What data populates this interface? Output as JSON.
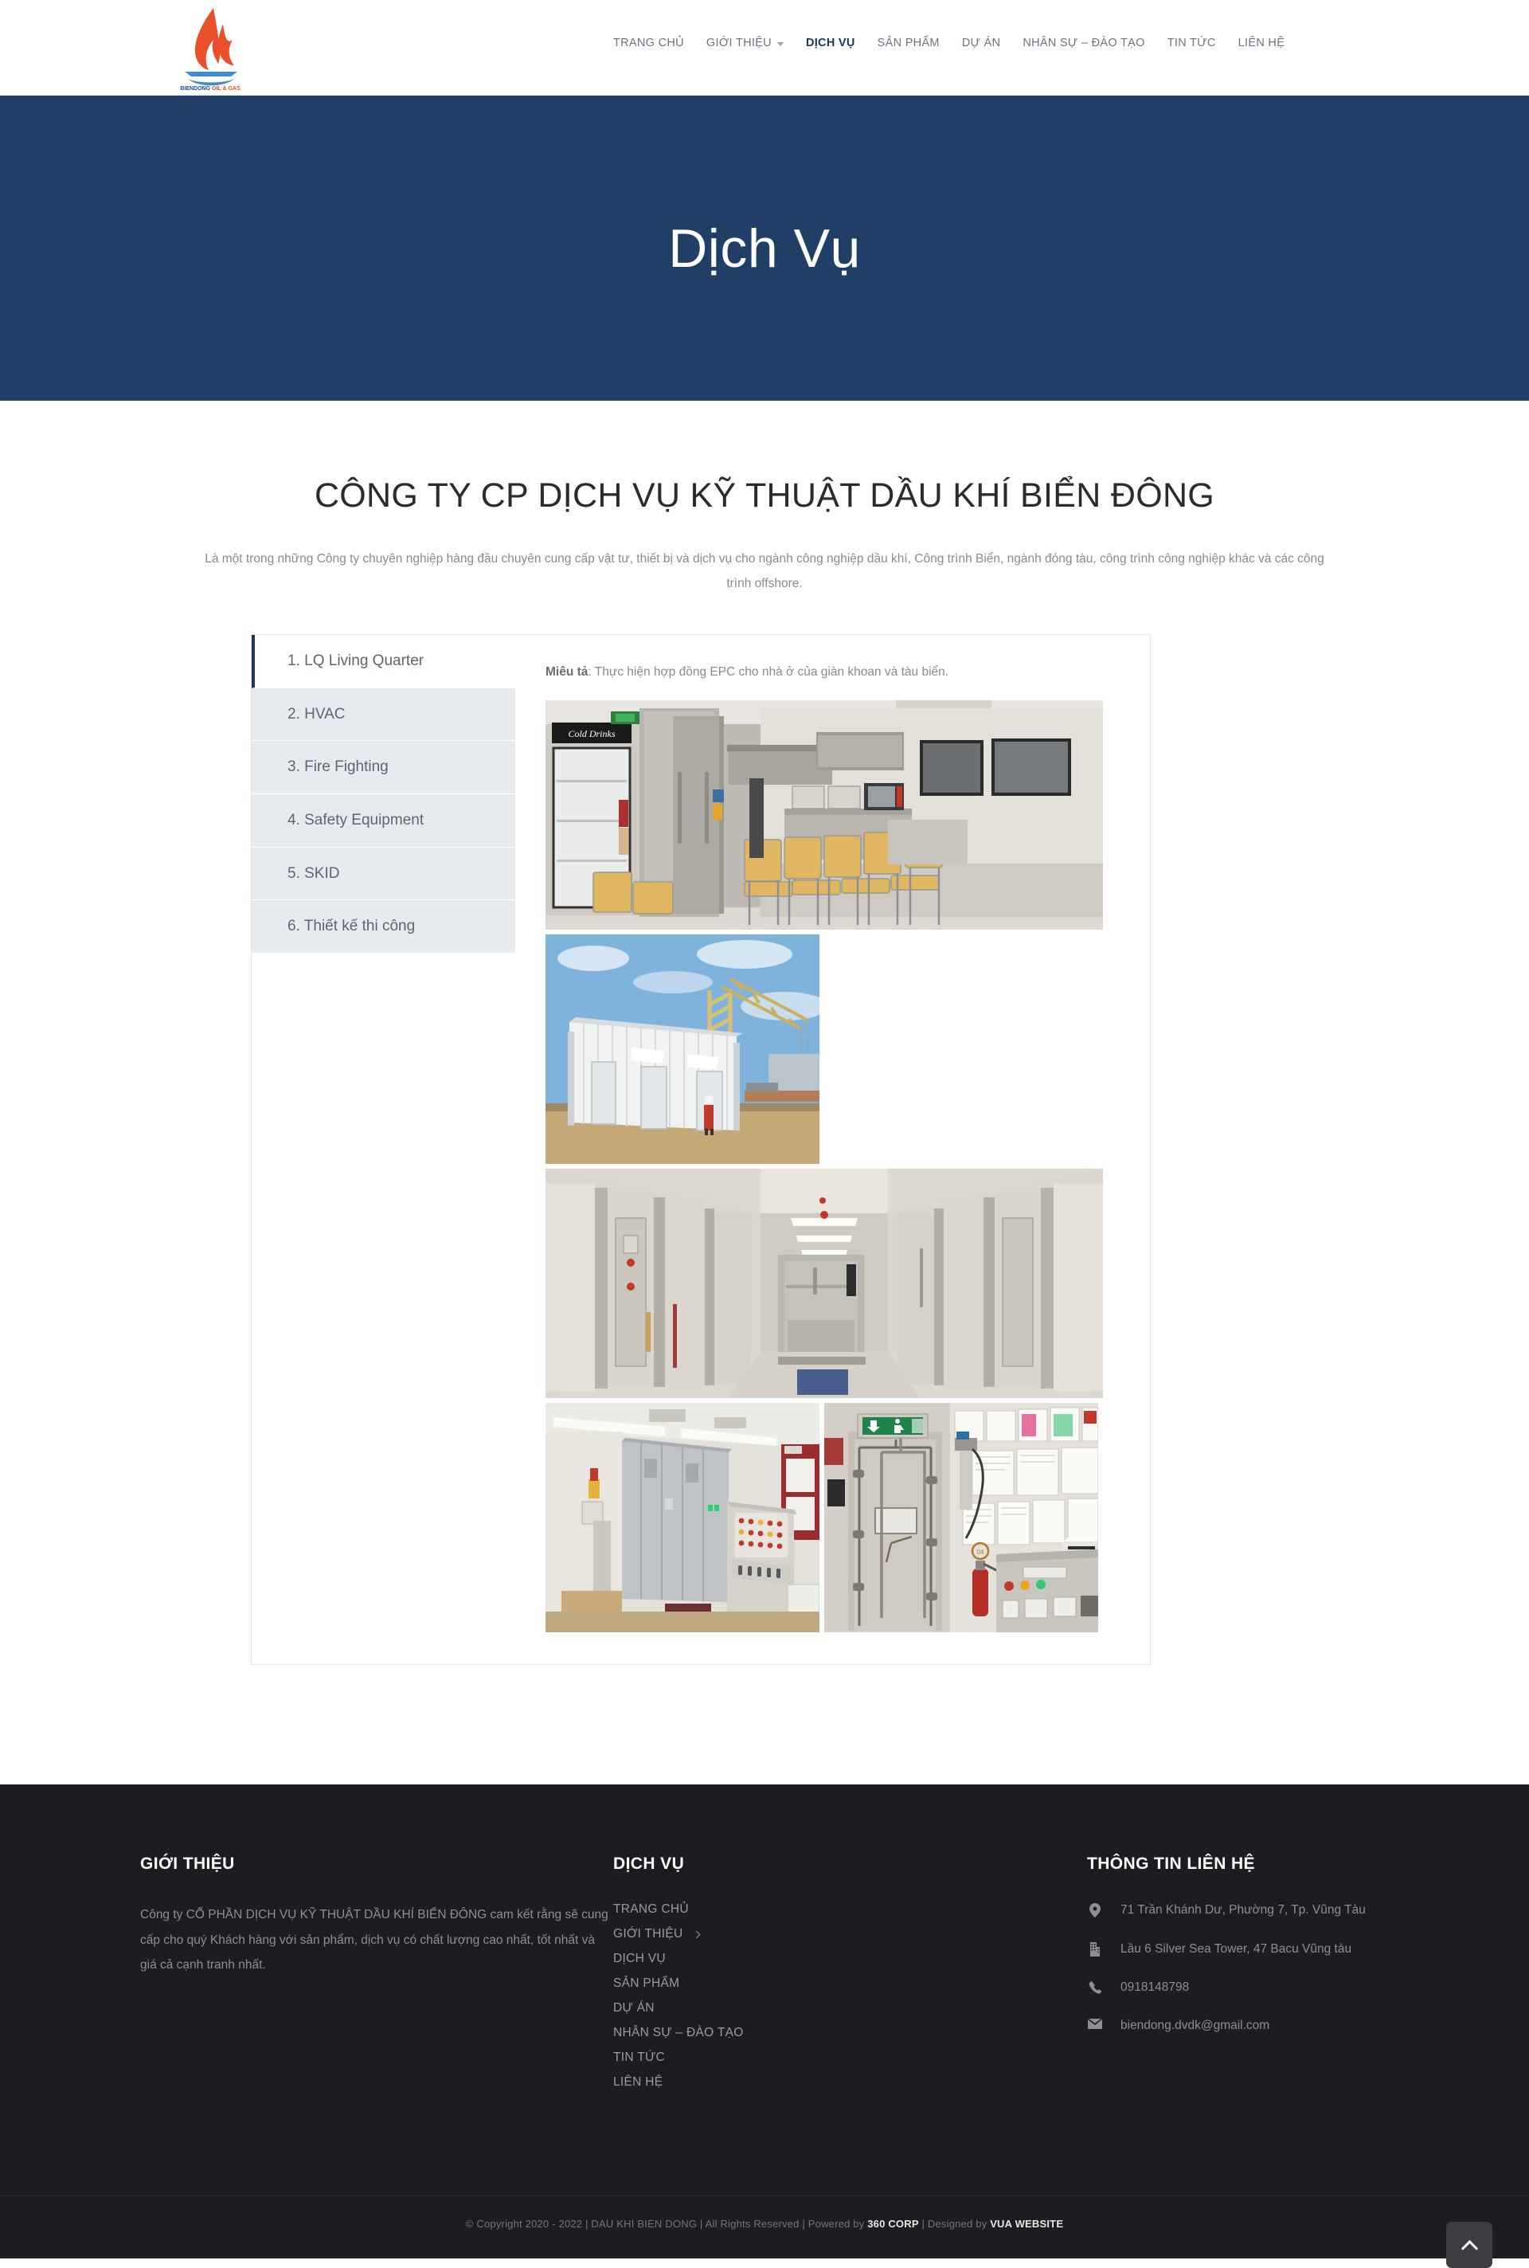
{
  "header": {
    "logo": {
      "name": "biendong-oil-gas-logo",
      "text": "BIENDONG OIL & GAS",
      "flame_color": "#e8502a",
      "wave_color": "#3b8ed0"
    },
    "nav": [
      {
        "label": "TRANG CHỦ",
        "active": false,
        "has_caret": false
      },
      {
        "label": "GIỚI THIỆU",
        "active": false,
        "has_caret": true
      },
      {
        "label": "DỊCH VỤ",
        "active": true,
        "has_caret": false
      },
      {
        "label": "SẢN PHẨM",
        "active": false,
        "has_caret": false
      },
      {
        "label": "DỰ ÁN",
        "active": false,
        "has_caret": false
      },
      {
        "label": "NHÂN SỰ – ĐÀO TẠO",
        "active": false,
        "has_caret": false
      },
      {
        "label": "TIN TỨC",
        "active": false,
        "has_caret": false
      },
      {
        "label": "LIÊN HỆ",
        "active": false,
        "has_caret": false
      }
    ]
  },
  "hero": {
    "title": "Dịch Vụ",
    "background_color": "#213f66"
  },
  "main": {
    "heading": "CÔNG TY CP DỊCH VỤ KỸ THUẬT DẦU KHÍ BIỂN ĐÔNG",
    "intro": "Là một trong những Công ty chuyên nghiệp hàng đầu chuyên cung cấp vật tư, thiết bị và dịch vụ cho ngành công nghiệp dầu khí, Công trình Biển, ngành đóng tàu, công trình công nghiệp khác và các công trình offshore.",
    "tabs": [
      {
        "label": "1. LQ Living Quarter",
        "active": true
      },
      {
        "label": "2. HVAC",
        "active": false
      },
      {
        "label": "3. Fire Fighting",
        "active": false
      },
      {
        "label": "4. Safety Equipment",
        "active": false
      },
      {
        "label": "5. SKID",
        "active": false
      },
      {
        "label": "6. Thiết kế thi công",
        "active": false
      }
    ],
    "panel": {
      "desc_label": "Miêu tả",
      "desc_text": ": Thực hiện hợp đồng EPC cho nhà ở của giàn khoan và tàu biển.",
      "photos": [
        {
          "name": "photo-galley-mess-room"
        },
        {
          "name": "photo-module-exterior-crane"
        },
        {
          "name": "photo-accommodation-corridor"
        },
        {
          "name": "photo-electrical-control-room"
        },
        {
          "name": "photo-watertight-door-panel"
        }
      ]
    }
  },
  "footer": {
    "col1": {
      "title": "GIỚI THIỆU",
      "text": "Công ty CỔ PHẦN DỊCH VỤ KỸ THUẬT DẦU KHÍ BIỂN ĐÔNG cam kết rằng sẽ cung cấp cho quý Khách hàng với sản phẩm, dịch vụ có chất lượng cao nhất, tốt nhất và giá cả cạnh tranh nhất."
    },
    "col2": {
      "title": "DỊCH VỤ",
      "links": [
        {
          "label": "TRANG CHỦ",
          "has_chevron": false
        },
        {
          "label": "GIỚI THIỆU",
          "has_chevron": true
        },
        {
          "label": "DỊCH VỤ",
          "has_chevron": false
        },
        {
          "label": "SẢN PHẨM",
          "has_chevron": false
        },
        {
          "label": "DỰ ÁN",
          "has_chevron": false
        },
        {
          "label": "NHÂN SỰ – ĐÀO TẠO",
          "has_chevron": false
        },
        {
          "label": "TIN TỨC",
          "has_chevron": false
        },
        {
          "label": "LIÊN HỆ",
          "has_chevron": false
        }
      ]
    },
    "col3": {
      "title": "THÔNG TIN LIÊN HỆ",
      "items": [
        {
          "icon": "map-pin-icon",
          "text": "71 Trần Khánh Dư, Phường 7, Tp. Vũng Tàu"
        },
        {
          "icon": "building-icon",
          "text": "Lầu 6 Silver Sea Tower, 47 Bacu Vũng tàu"
        },
        {
          "icon": "phone-icon",
          "text": "0918148798"
        },
        {
          "icon": "envelope-icon",
          "text": "biendong.dvdk@gmail.com"
        }
      ]
    },
    "copyright": {
      "part1": "© Copyright 2020 - 2022 | DAU KHI BIEN DONG |  All Rights Reserved | Powered by ",
      "brand1": "360 CORP",
      "part2": " | Designed by ",
      "brand2": "VUA WEBSITE"
    },
    "to_top_label": "Lên đầu trang"
  }
}
